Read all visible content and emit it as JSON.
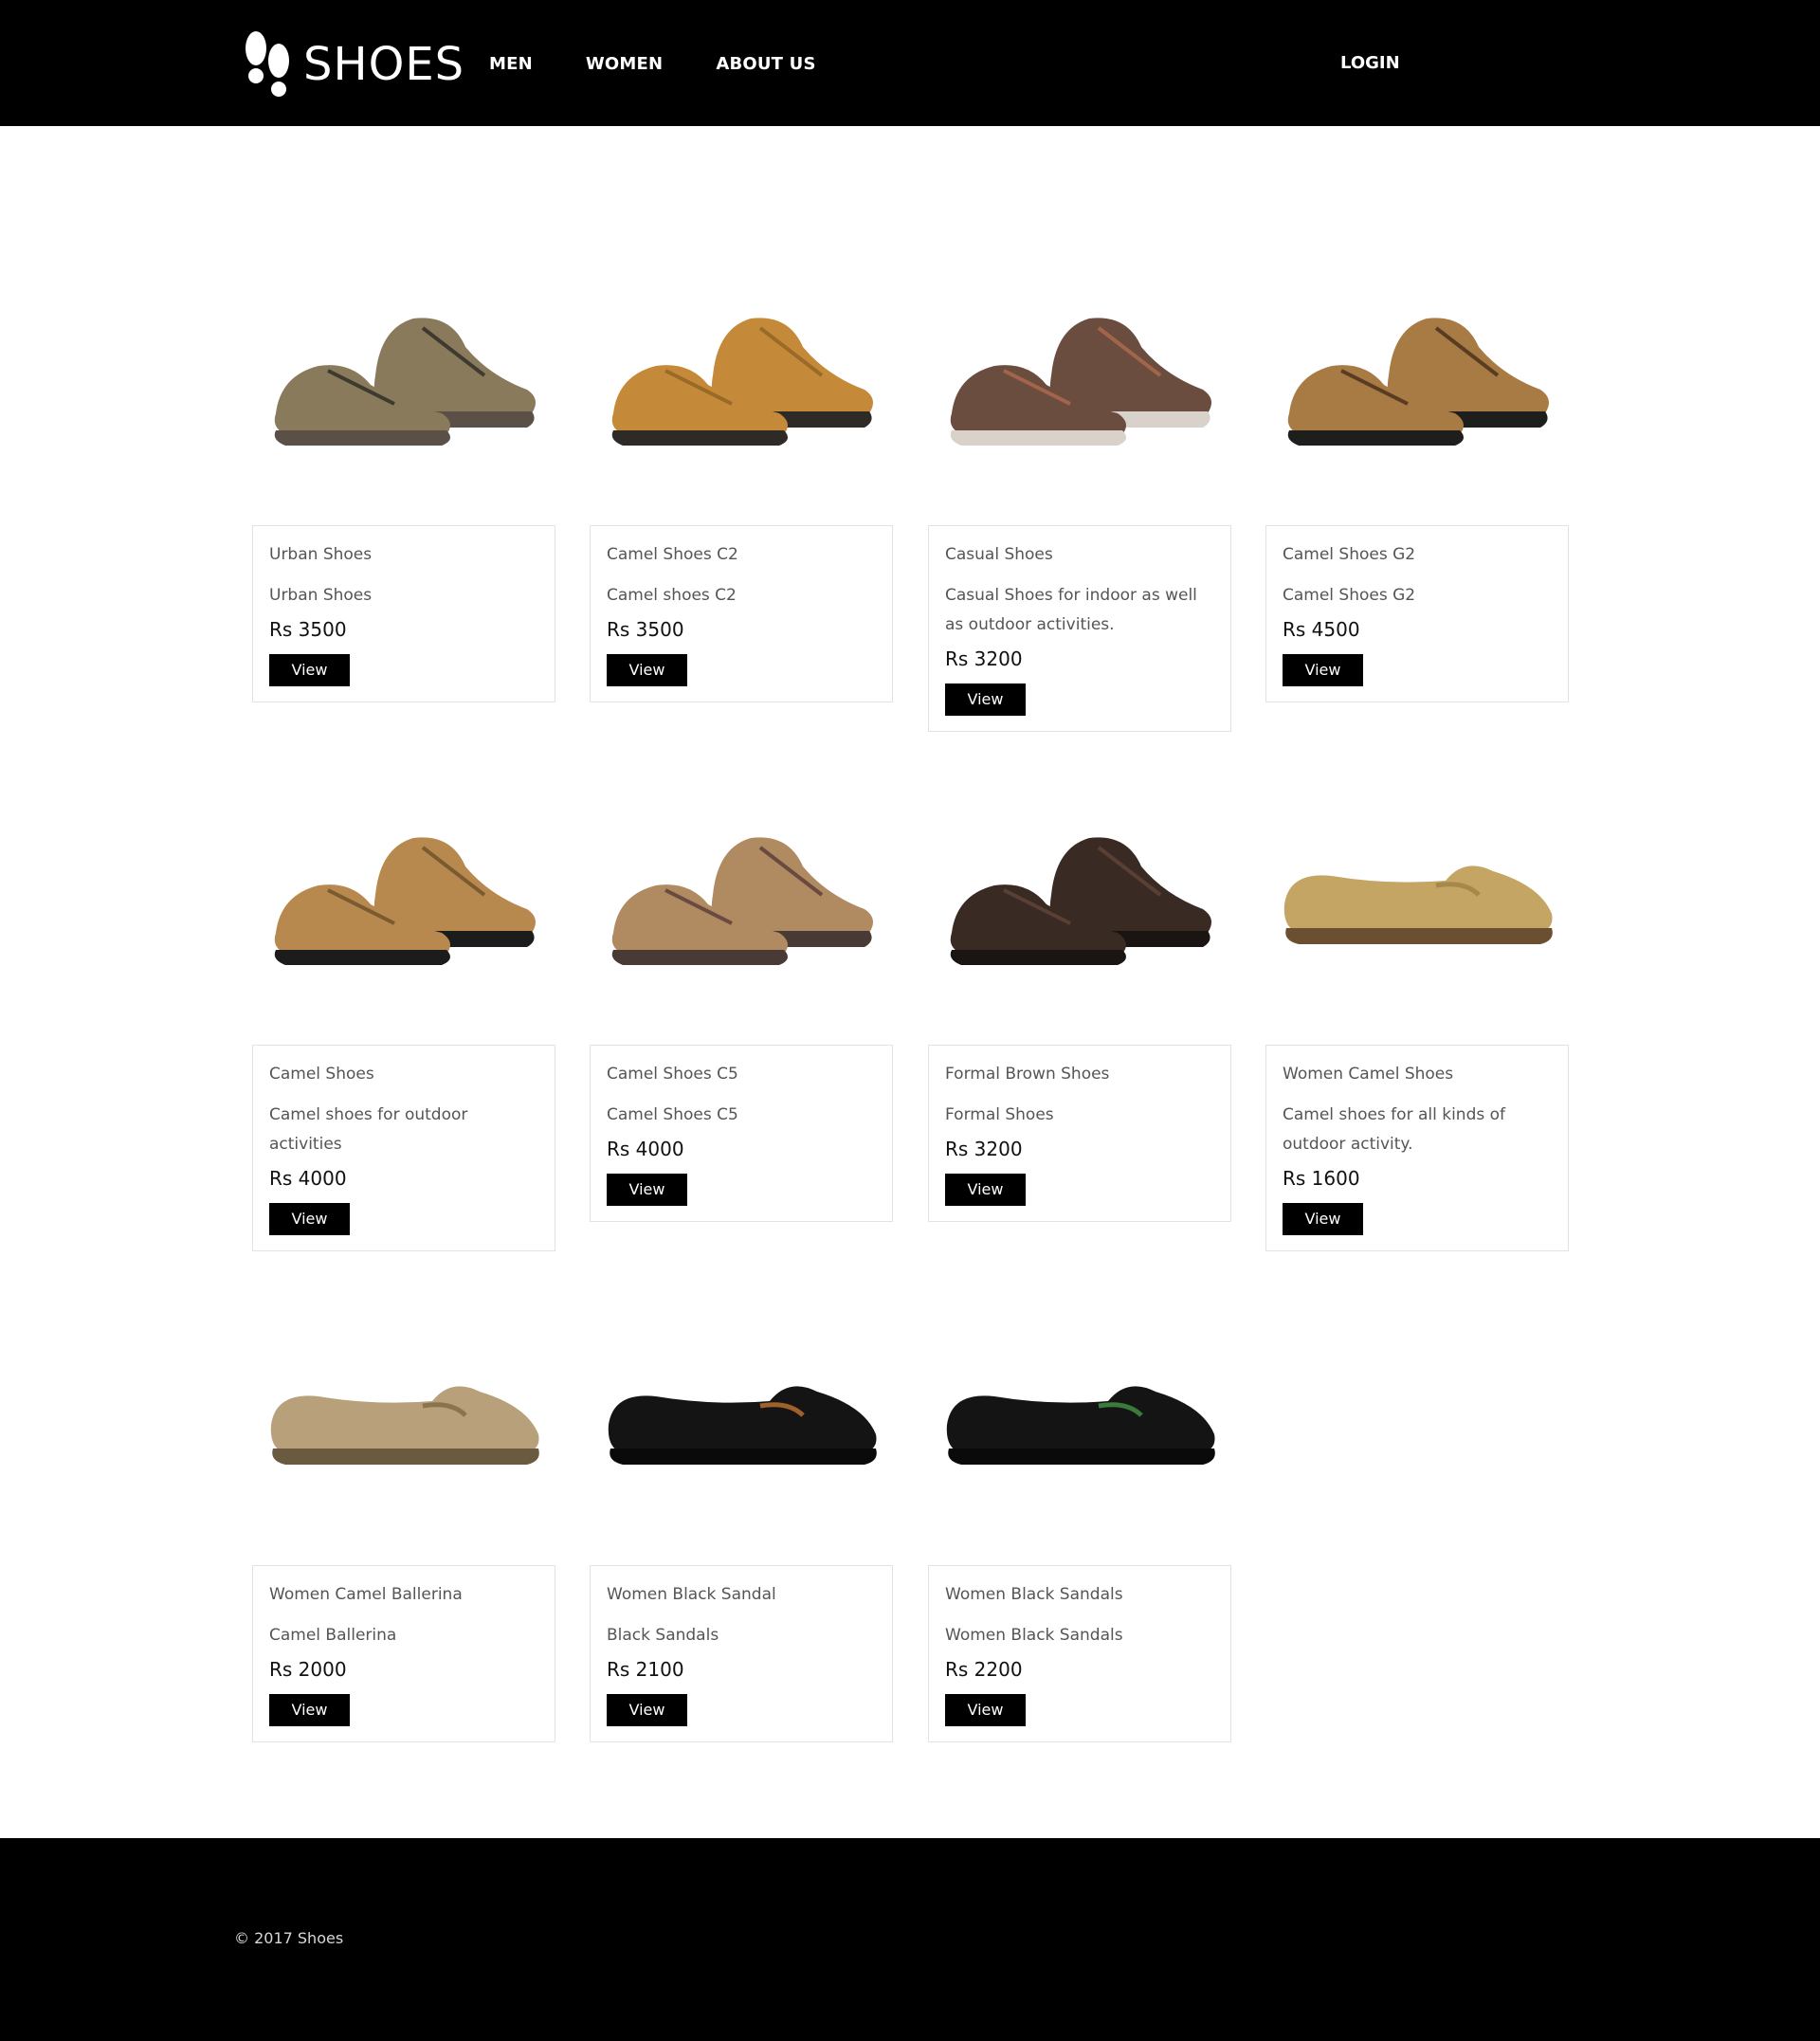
{
  "brand": {
    "logo_text": "SHOES"
  },
  "nav": {
    "items": [
      {
        "label": "MEN"
      },
      {
        "label": "WOMEN"
      },
      {
        "label": "ABOUT US"
      }
    ],
    "login_label": "LOGIN"
  },
  "products": [
    {
      "title": "Urban Shoes",
      "description": "Urban Shoes",
      "price": "Rs 3500",
      "button": "View",
      "image": "urban-shoes-image",
      "colors": {
        "upper": "#8a7a5c",
        "sole": "#5a5048",
        "accent": "#3e3a30"
      }
    },
    {
      "title": "Camel Shoes C2",
      "description": "Camel shoes C2",
      "price": "Rs 3500",
      "button": "View",
      "image": "camel-shoes-c2-image",
      "colors": {
        "upper": "#c48a3a",
        "sole": "#2e2a26",
        "accent": "#9a6a28"
      }
    },
    {
      "title": "Casual Shoes",
      "description": "Casual Shoes for indoor as well as outdoor activities.",
      "price": "Rs 3200",
      "button": "View",
      "image": "casual-shoes-image",
      "colors": {
        "upper": "#6b4d40",
        "sole": "#d8d2ca",
        "accent": "#a3654a"
      }
    },
    {
      "title": "Camel Shoes G2",
      "description": "Camel Shoes G2",
      "price": "Rs 4500",
      "button": "View",
      "image": "camel-shoes-g2-image",
      "colors": {
        "upper": "#a87b45",
        "sole": "#1e1e1c",
        "accent": "#5a3c22"
      }
    },
    {
      "title": "Camel Shoes",
      "description": "Camel shoes for outdoor activities",
      "price": "Rs 4000",
      "button": "View",
      "image": "camel-shoes-image",
      "colors": {
        "upper": "#b8894e",
        "sole": "#1c1c1c",
        "accent": "#7a5a30"
      }
    },
    {
      "title": "Camel Shoes C5",
      "description": "Camel Shoes C5",
      "price": "Rs 4000",
      "button": "View",
      "image": "camel-shoes-c5-image",
      "colors": {
        "upper": "#b08a60",
        "sole": "#4a3a36",
        "accent": "#6a4a40"
      }
    },
    {
      "title": "Formal Brown Shoes",
      "description": "Formal Shoes",
      "price": "Rs 3200",
      "button": "View",
      "image": "formal-brown-shoes-image",
      "colors": {
        "upper": "#3a2a24",
        "sole": "#1a1412",
        "accent": "#5a4034"
      }
    },
    {
      "title": "Women Camel Shoes",
      "description": "Camel shoes for all kinds of outdoor activity.",
      "price": "Rs 1600",
      "button": "View",
      "image": "women-camel-shoes-image",
      "colors": {
        "upper": "#c4a564",
        "sole": "#6a5030",
        "accent": "#a8884a"
      }
    },
    {
      "title": "Women Camel Ballerina",
      "description": "Camel Ballerina",
      "price": "Rs 2000",
      "button": "View",
      "image": "women-camel-ballerina-image",
      "colors": {
        "upper": "#b8a07a",
        "sole": "#6a5a40",
        "accent": "#8a7450"
      }
    },
    {
      "title": "Women Black Sandal",
      "description": "Black Sandals",
      "price": "Rs 2100",
      "button": "View",
      "image": "women-black-sandal-image",
      "colors": {
        "upper": "#141414",
        "sole": "#0a0a0a",
        "accent": "#a0602a"
      }
    },
    {
      "title": "Women Black Sandals",
      "description": "Women Black Sandals",
      "price": "Rs 2200",
      "button": "View",
      "image": "women-black-sandals-image",
      "colors": {
        "upper": "#141414",
        "sole": "#0a0a0a",
        "accent": "#3a7a3a"
      }
    }
  ],
  "footer": {
    "copyright": "© 2017 Shoes"
  }
}
